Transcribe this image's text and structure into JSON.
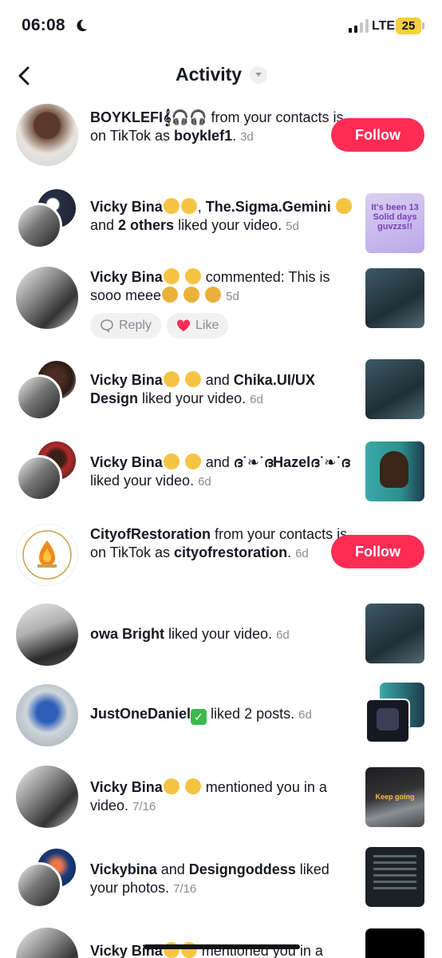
{
  "status": {
    "time": "06:08",
    "network": "LTE",
    "battery": "25"
  },
  "header": {
    "title": "Activity"
  },
  "notifications": [
    {
      "name": "BOYKLEFI𝄞🎧🎧",
      "mid": " from your contacts is on TikTok as ",
      "handle": "boyklef1",
      "time": "3d",
      "action": "Follow"
    },
    {
      "name": "Vicky Bina",
      "mid1": ", ",
      "name2": "The.Sigma.Gemini",
      "mid2": " and ",
      "name3": "2 others",
      "tail": " liked your video.",
      "time": "5d",
      "thumb_text": "It's been 13 Solid days guvzzs!!"
    },
    {
      "name": "Vicky Bina",
      "tail": " commented: This is sooo meee",
      "time": "5d",
      "reply": "Reply",
      "like": "Like"
    },
    {
      "name": "Vicky Bina",
      "mid": " and ",
      "name2": "Chika.UI/UX Design",
      "tail": " liked your video.",
      "time": "6d"
    },
    {
      "name": "Vicky Bina",
      "mid": " and ",
      "name2": "ദ˙❧˙ദHazelദ˙❧˙ദ",
      "tail": " liked your video.",
      "time": "6d"
    },
    {
      "name": "CityofRestoration",
      "mid": " from your contacts is on TikTok as ",
      "handle": "cityofrestoration",
      "time": "6d",
      "action": "Follow",
      "logo_text": "CITY OF RESTORATION FAMILY WORLDWIDE INC"
    },
    {
      "name": "owa Bright",
      "tail": " liked your video.",
      "time": "6d"
    },
    {
      "name": "JustOneDaniel",
      "tail": " liked 2 posts.",
      "time": "6d"
    },
    {
      "name": "Vicky Bina",
      "tail": " mentioned you in a video.",
      "time": "7/16",
      "thumb_text": "Keep going"
    },
    {
      "name": "Vickybina",
      "mid": " and ",
      "name2": "Designgoddess",
      "tail": " liked your photos.",
      "time": "7/16"
    },
    {
      "name": "Vicky Bina",
      "tail": " mentioned you in a"
    }
  ],
  "colors": {
    "follow": "#fe2c55",
    "text": "#161823",
    "muted": "#8a8b91"
  }
}
